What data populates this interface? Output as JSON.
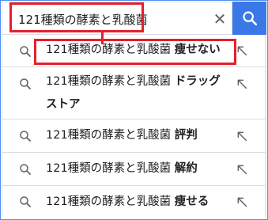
{
  "search": {
    "query": "121種類の酵素と乳酸菌"
  },
  "suggestions": [
    {
      "prefix": "121種類の酵素と乳酸菌",
      "suffix": "痩せない"
    },
    {
      "prefix": "121種類の酵素と乳酸菌",
      "suffix": "ドラッグストア"
    },
    {
      "prefix": "121種類の酵素と乳酸菌",
      "suffix": "評判"
    },
    {
      "prefix": "121種類の酵素と乳酸菌",
      "suffix": "解約"
    },
    {
      "prefix": "121種類の酵素と乳酸菌",
      "suffix": "痩せる"
    }
  ],
  "icons": {
    "search": "search-icon",
    "clear": "close-icon",
    "suggestion": "search-icon",
    "fill": "arrow-up-left-icon"
  },
  "colors": {
    "highlight": "#e3202c",
    "search_button": "#3b78e7",
    "frame": "#4e8ef0"
  }
}
